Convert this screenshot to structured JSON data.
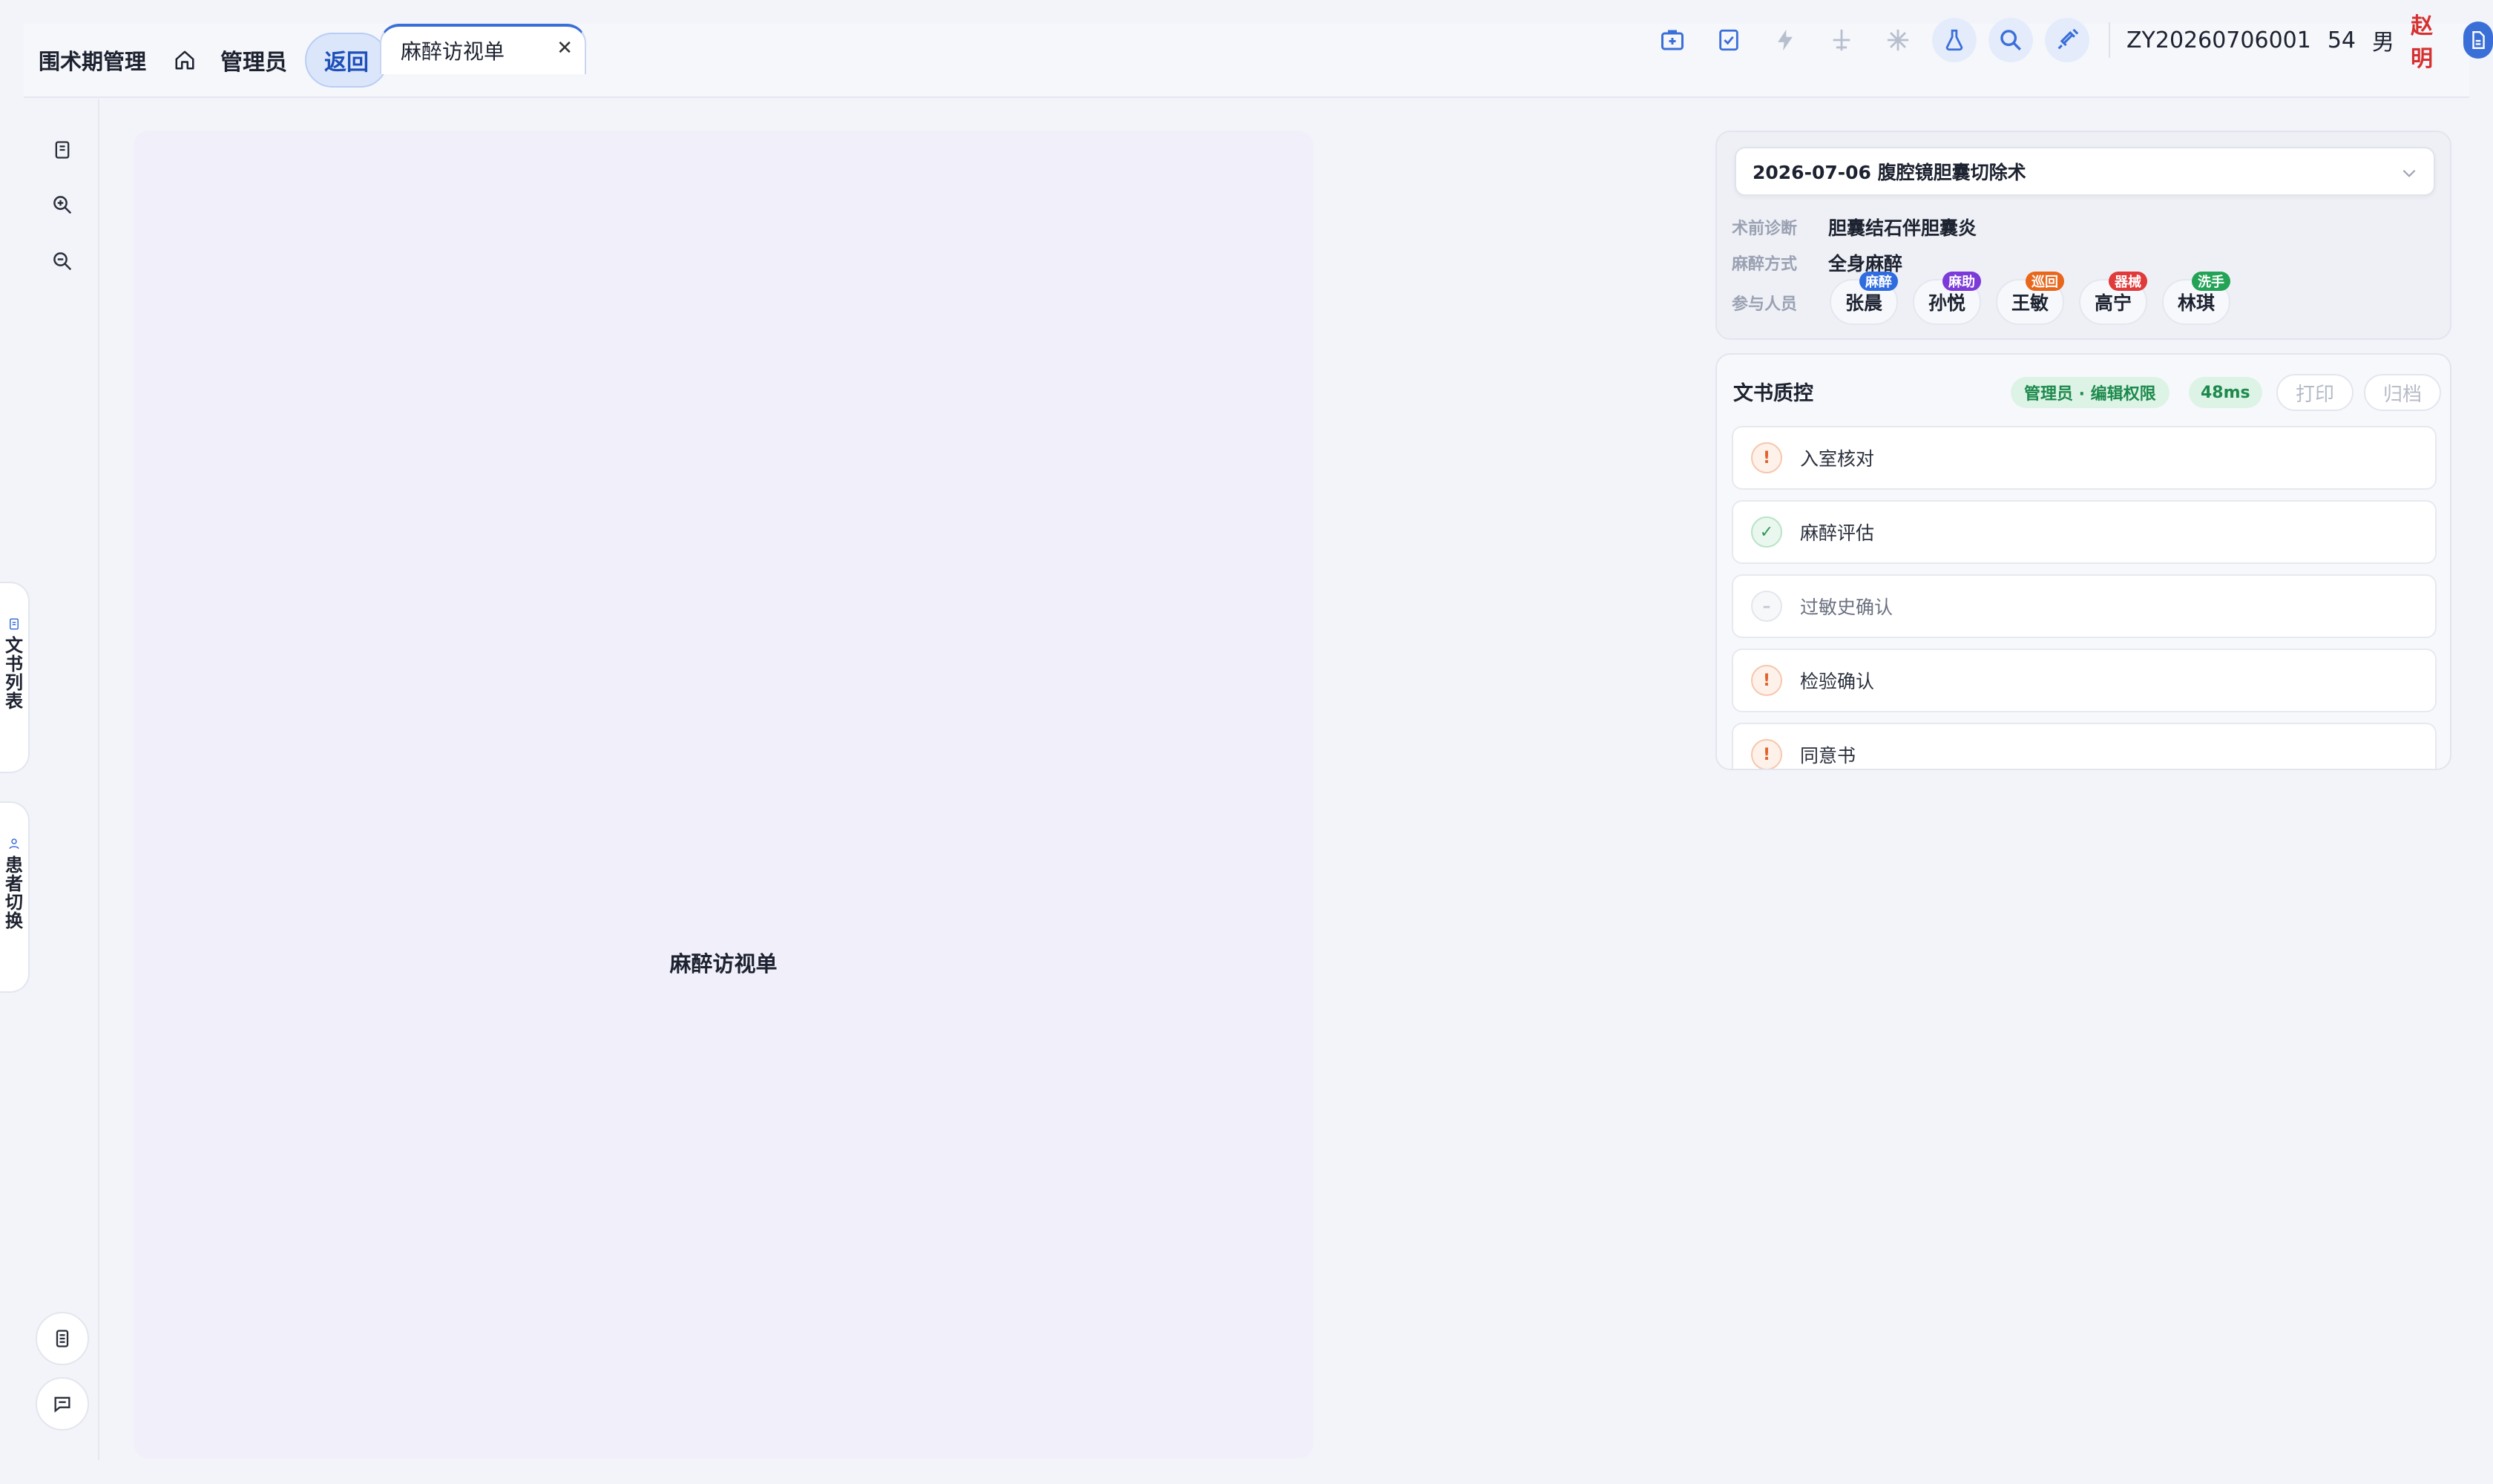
{
  "header": {
    "app_title": "围术期管理",
    "user_name": "管理员",
    "back_label": "返回",
    "doc_tab": {
      "label": "麻醉访视单",
      "close": "✕"
    },
    "tools": [
      {
        "name": "first-aid-icon",
        "active": false
      },
      {
        "name": "checklist-icon",
        "active": false
      },
      {
        "name": "flash-icon",
        "active": false
      },
      {
        "name": "plane-icon",
        "active": false
      },
      {
        "name": "snowflake-icon",
        "active": false
      },
      {
        "name": "flask-icon",
        "active": true
      },
      {
        "name": "search-icon",
        "active": true
      },
      {
        "name": "syringe-icon",
        "active": true
      }
    ],
    "patient": {
      "id": "ZY20260706001",
      "age": "54",
      "gender": "男",
      "name": "赵明"
    }
  },
  "left_rail": {
    "drawers": [
      {
        "label": "文书列表",
        "icon": "document-icon"
      },
      {
        "label": "患者切换",
        "icon": "user-icon"
      }
    ]
  },
  "document": {
    "title": "麻醉访视单"
  },
  "surgery": {
    "selected": "2026-07-06 腹腔镜胆囊切除术",
    "diagnosis_label": "术前诊断",
    "diagnosis": "胆囊结石伴胆囊炎",
    "anesthesia_label": "麻醉方式",
    "anesthesia": "全身麻醉",
    "staff_label": "参与人员",
    "staff": [
      {
        "name": "张晨",
        "role": "麻醉",
        "color": "#2f6ce0"
      },
      {
        "name": "孙悦",
        "role": "麻助",
        "color": "#7c3ad8"
      },
      {
        "name": "王敏",
        "role": "巡回",
        "color": "#e8671c"
      },
      {
        "name": "高宁",
        "role": "器械",
        "color": "#e03a3a"
      },
      {
        "name": "林琪",
        "role": "洗手",
        "color": "#22a356"
      }
    ]
  },
  "qc": {
    "title": "文书质控",
    "permission": "管理员 · 编辑权限",
    "latency": "48ms",
    "print_label": "打印",
    "archive_label": "归档",
    "items": [
      {
        "label": "入室核对",
        "status": "warn",
        "symbol": "!"
      },
      {
        "label": "麻醉评估",
        "status": "ok",
        "symbol": "✓"
      },
      {
        "label": "过敏史确认",
        "status": "none",
        "symbol": "–"
      },
      {
        "label": "检验确认",
        "status": "warn",
        "symbol": "!"
      },
      {
        "label": "同意书",
        "status": "warn",
        "symbol": "!"
      }
    ]
  }
}
